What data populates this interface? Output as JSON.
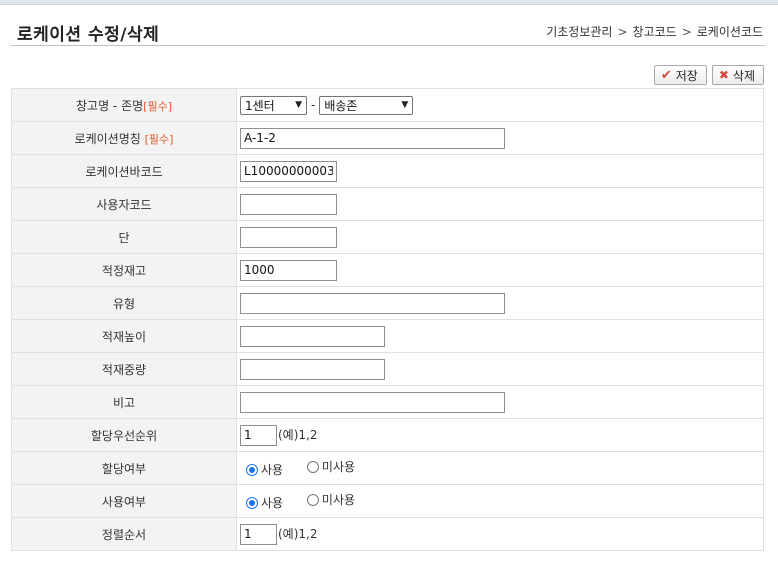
{
  "header": {
    "title": "로케이션 수정/삭제",
    "breadcrumb": [
      "기초정보관리",
      "창고코드",
      "로케이션코드"
    ],
    "separator": ">"
  },
  "toolbar": {
    "save_label": "저장",
    "delete_label": "삭제"
  },
  "form": {
    "required_tag": "[필수]",
    "warehouse": {
      "label": "창고명 - 존명",
      "center_value": "1센터",
      "zone_value": "배송존",
      "dash": "-"
    },
    "location_name": {
      "label": "로케이션명칭",
      "value": "A-1-2"
    },
    "location_barcode": {
      "label": "로케이션바코드",
      "value": "L10000000003"
    },
    "user_code": {
      "label": "사용자코드",
      "value": ""
    },
    "tier": {
      "label": "단",
      "value": ""
    },
    "proper_stock": {
      "label": "적정재고",
      "value": "1000"
    },
    "type": {
      "label": "유형",
      "value": ""
    },
    "stack_height": {
      "label": "적재높이",
      "value": ""
    },
    "stack_weight": {
      "label": "적재중량",
      "value": ""
    },
    "remarks": {
      "label": "비고",
      "value": ""
    },
    "alloc_priority": {
      "label": "할당우선순위",
      "value": "1",
      "hint": "(예)1,2"
    },
    "alloc_flag": {
      "label": "할당여부",
      "options": [
        "사용",
        "미사용"
      ],
      "selected": "사용"
    },
    "use_flag": {
      "label": "사용여부",
      "options": [
        "사용",
        "미사용"
      ],
      "selected": "사용"
    },
    "sort_order": {
      "label": "정렬순서",
      "value": "1",
      "hint": "(예)1,2"
    }
  },
  "colors": {
    "accent_red": "#d24b3a",
    "required": "#e05a2a",
    "radio_blue": "#1a73e8",
    "label_bg": "#f3f3f3"
  }
}
